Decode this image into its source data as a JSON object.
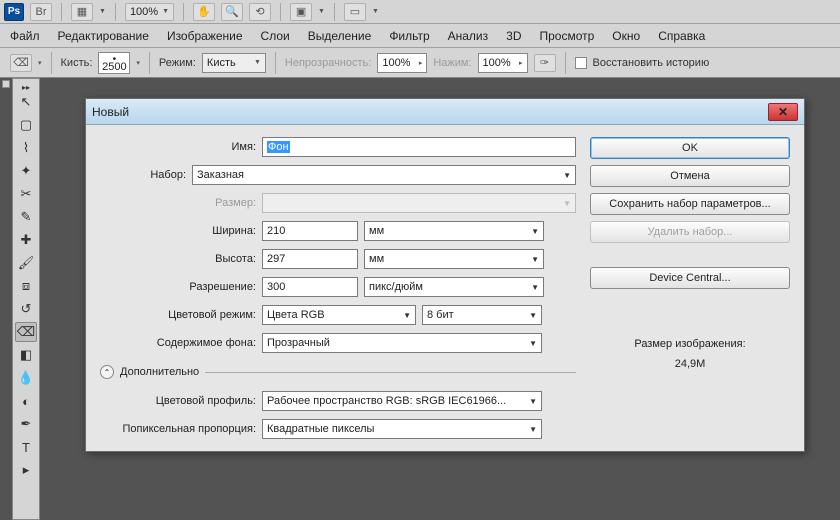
{
  "topbar": {
    "zoom": "100%"
  },
  "menu": {
    "file": "Файл",
    "edit": "Редактирование",
    "image": "Изображение",
    "layer": "Слои",
    "select": "Выделение",
    "filter": "Фильтр",
    "analysis": "Анализ",
    "threeD": "3D",
    "view": "Просмотр",
    "window": "Окно",
    "help": "Справка"
  },
  "options": {
    "brush_label": "Кисть:",
    "brush_size": "2500",
    "mode_label": "Режим:",
    "mode_value": "Кисть",
    "opacity_label": "Непрозрачность:",
    "opacity_value": "100%",
    "flow_label": "Нажим:",
    "flow_value": "100%",
    "restore": "Восстановить историю"
  },
  "dialog": {
    "title": "Новый",
    "name_label": "Имя:",
    "name_value": "Фон",
    "preset_label": "Набор:",
    "preset_value": "Заказная",
    "size_label": "Размер:",
    "size_value": "",
    "width_label": "Ширина:",
    "width_value": "210",
    "width_unit": "мм",
    "height_label": "Высота:",
    "height_value": "297",
    "height_unit": "мм",
    "res_label": "Разрешение:",
    "res_value": "300",
    "res_unit": "пикс/дюйм",
    "mode_label": "Цветовой режим:",
    "mode_value": "Цвета RGB",
    "mode_bits": "8 бит",
    "bg_label": "Содержимое фона:",
    "bg_value": "Прозрачный",
    "adv": "Дополнительно",
    "profile_label": "Цветовой профиль:",
    "profile_value": "Рабочее пространство RGB: sRGB IEC61966...",
    "aspect_label": "Попиксельная пропорция:",
    "aspect_value": "Квадратные пикселы",
    "ok": "OK",
    "cancel": "Отмена",
    "save": "Сохранить набор параметров...",
    "delete": "Удалить набор...",
    "device": "Device Central...",
    "info_label": "Размер изображения:",
    "info_value": "24,9M"
  }
}
